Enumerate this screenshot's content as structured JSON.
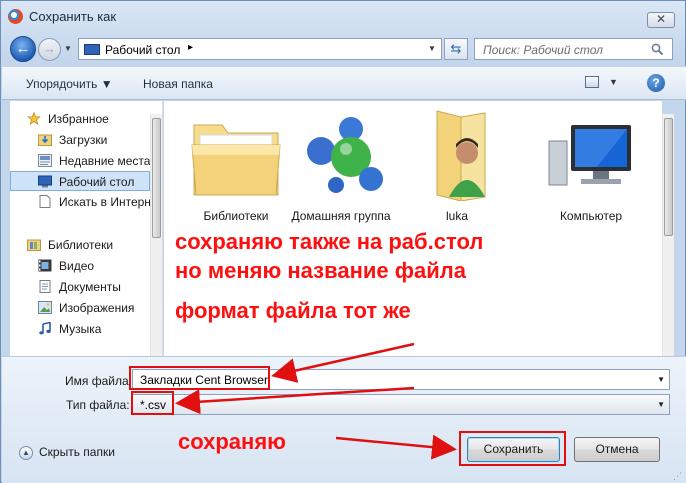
{
  "window": {
    "title": "Сохранить как",
    "close_glyph": "✕"
  },
  "address": {
    "location": "Рабочий стол",
    "separator": "▸",
    "dropdown": "▼",
    "refresh": "⇆",
    "search_placeholder": "Поиск: Рабочий стол"
  },
  "toolbar": {
    "organize": "Упорядочить ▼",
    "new_folder": "Новая папка",
    "view_drop": "▼",
    "help": "?"
  },
  "sidebar": {
    "items": [
      {
        "label": "Избранное",
        "icon": "star-icon"
      },
      {
        "label": "Загрузки",
        "icon": "downloads-folder-icon"
      },
      {
        "label": "Недавние места",
        "icon": "recent-places-icon"
      },
      {
        "label": "Рабочий стол",
        "icon": "desktop-icon",
        "selected": true
      },
      {
        "label": "Искать в Интернете",
        "icon": "web-search-icon"
      },
      {
        "label": "Библиотеки",
        "icon": "libraries-icon"
      },
      {
        "label": "Видео",
        "icon": "video-icon"
      },
      {
        "label": "Документы",
        "icon": "documents-icon"
      },
      {
        "label": "Изображения",
        "icon": "pictures-icon"
      },
      {
        "label": "Музыка",
        "icon": "music-icon"
      }
    ]
  },
  "files": {
    "items": [
      {
        "label": "Библиотеки",
        "icon": "libraries-folder-icon"
      },
      {
        "label": "Домашняя группа",
        "icon": "homegroup-icon"
      },
      {
        "label": "luka",
        "icon": "user-folder-icon"
      },
      {
        "label": "Компьютер",
        "icon": "computer-icon"
      }
    ]
  },
  "form": {
    "filename_label": "Имя файла:",
    "filename_value": "Закладки Cent Browser",
    "filetype_label": "Тип файла:",
    "filetype_value": "*.csv",
    "dropdown_arrow": "▼",
    "hide_folders": "Скрыть папки",
    "hide_folders_glyph": "▲",
    "save": "Сохранить",
    "cancel": "Отмена"
  },
  "annotations": {
    "line1": "сохраняю также на раб.стол",
    "line2": "но меняю название файла",
    "line3": "формат файла тот же",
    "line4": "сохраняю",
    "color": "#ff1010"
  }
}
